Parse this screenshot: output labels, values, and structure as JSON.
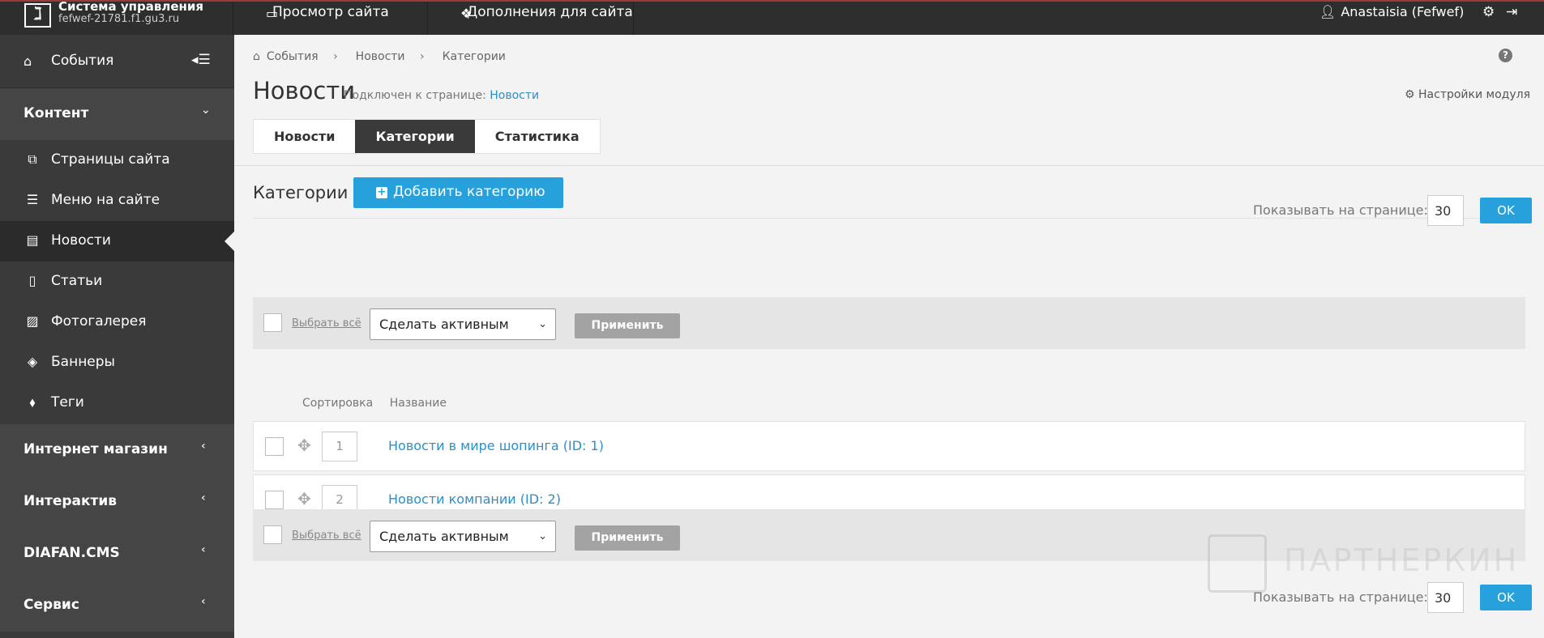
{
  "topbar": {
    "brand_title": "Система управления",
    "brand_domain": "fefwef-21781.f1.gu3.ru",
    "view_site": "Просмотр сайта",
    "addons": "Дополнения для сайта",
    "user": "Anastaisia (Fefwef)"
  },
  "sidebar": {
    "events": "События",
    "sections": [
      {
        "label": "Контент"
      },
      {
        "label": "Интернет магазин"
      },
      {
        "label": "Интерактив"
      },
      {
        "label": "DIAFAN.CMS"
      },
      {
        "label": "Сервис"
      }
    ],
    "items": [
      {
        "label": "Страницы сайта",
        "icon": "pages-icon"
      },
      {
        "label": "Меню на сайте",
        "icon": "list-icon"
      },
      {
        "label": "Новости",
        "icon": "newspaper-icon"
      },
      {
        "label": "Статьи",
        "icon": "document-icon"
      },
      {
        "label": "Фотогалерея",
        "icon": "image-icon"
      },
      {
        "label": "Баннеры",
        "icon": "tag-icon"
      },
      {
        "label": "Теги",
        "icon": "tags-icon"
      }
    ]
  },
  "main": {
    "breadcrumb": [
      "События",
      "Новости",
      "Категории"
    ],
    "page_title": "Новости",
    "attached_label": "Подключен к странице:",
    "attached_link": "Новости",
    "module_settings": "Настройки модуля",
    "tabs": [
      {
        "label": "Новости",
        "active": false
      },
      {
        "label": "Категории",
        "active": true
      },
      {
        "label": "Статистика",
        "active": false
      }
    ],
    "section_title": "Категории",
    "add_button": "Добавить категорию",
    "per_page_label": "Показывать на странице:",
    "per_page_value": "30",
    "ok": "OK",
    "select_all": "Выбрать всё",
    "bulk_action": "Сделать активным",
    "apply": "Применить",
    "col_sort": "Сортировка",
    "col_name": "Название",
    "rows": [
      {
        "sort": "1",
        "name": "Новости в мире шопинга (ID: 1)"
      },
      {
        "sort": "2",
        "name": "Новости компании (ID: 2)"
      }
    ]
  },
  "watermark": "ПАРТНЕРКИН",
  "colors": {
    "accent": "#27a1dc",
    "link": "#2c8fc9",
    "sidebar": "#3a3a3a",
    "topbar": "#2e2e2e"
  }
}
